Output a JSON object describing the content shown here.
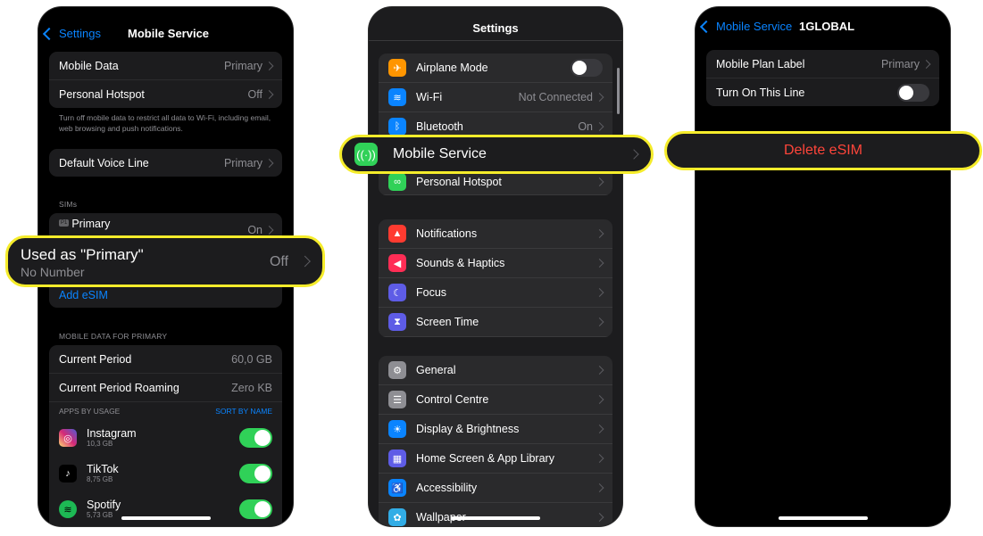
{
  "panel1": {
    "back_label": "Settings",
    "title": "Mobile Service",
    "group1": [
      {
        "label": "Mobile Data",
        "value": "Primary"
      },
      {
        "label": "Personal Hotspot",
        "value": "Off"
      }
    ],
    "footnote": "Turn off mobile data to restrict all data to Wi-Fi, including email, web browsing and push notifications.",
    "default_voice": {
      "label": "Default Voice Line",
      "value": "Primary"
    },
    "sims_header": "SIMs",
    "sim_badge": "P1",
    "sim_label": "Primary",
    "sim_value": "On",
    "add_esim": "Add eSIM",
    "data_header": "MOBILE DATA FOR PRIMARY",
    "current_period": {
      "label": "Current Period",
      "value": "60,0 GB"
    },
    "roaming": {
      "label": "Current Period Roaming",
      "value": "Zero KB"
    },
    "apps_header": "APPS BY USAGE",
    "sort_label": "SORT BY NAME",
    "apps": [
      {
        "name": "Instagram",
        "size": "10,3 GB",
        "on": true
      },
      {
        "name": "TikTok",
        "size": "8,75 GB",
        "on": true
      },
      {
        "name": "Spotify",
        "size": "5,73 GB",
        "on": true
      }
    ],
    "callout": {
      "title": "Used as \"Primary\"",
      "subtitle": "No Number",
      "value": "Off"
    }
  },
  "panel2": {
    "title": "Settings",
    "group1": [
      {
        "label": "Airplane Mode",
        "icon": "airplane-icon",
        "color": "#ff9500",
        "toggle": false
      },
      {
        "label": "Wi-Fi",
        "icon": "wifi-icon",
        "color": "#0a84ff",
        "value": "Not Connected"
      },
      {
        "label": "Bluetooth",
        "icon": "bluetooth-icon",
        "color": "#0a84ff",
        "value": "On"
      },
      {
        "label": "Personal Hotspot",
        "icon": "hotspot-icon",
        "color": "#30d158"
      }
    ],
    "group2": [
      {
        "label": "Notifications",
        "icon": "bell-icon",
        "color": "#ff3b30"
      },
      {
        "label": "Sounds & Haptics",
        "icon": "speaker-icon",
        "color": "#ff2d55"
      },
      {
        "label": "Focus",
        "icon": "moon-icon",
        "color": "#5e5ce6"
      },
      {
        "label": "Screen Time",
        "icon": "hourglass-icon",
        "color": "#5e5ce6"
      }
    ],
    "group3": [
      {
        "label": "General",
        "icon": "gear-icon",
        "color": "#8e8e93"
      },
      {
        "label": "Control Centre",
        "icon": "switches-icon",
        "color": "#8e8e93"
      },
      {
        "label": "Display & Brightness",
        "icon": "sun-icon",
        "color": "#0a84ff"
      },
      {
        "label": "Home Screen & App Library",
        "icon": "grid-icon",
        "color": "#5e5ce6"
      },
      {
        "label": "Accessibility",
        "icon": "accessibility-icon",
        "color": "#0a84ff"
      },
      {
        "label": "Wallpaper",
        "icon": "flower-icon",
        "color": "#32ade6"
      }
    ],
    "callout": {
      "label": "Mobile Service",
      "icon": "antenna-icon",
      "color": "#30d158"
    }
  },
  "panel3": {
    "back_label": "Mobile Service",
    "title": "1GLOBAL",
    "plan_label": {
      "label": "Mobile Plan Label",
      "value": "Primary"
    },
    "turn_on": {
      "label": "Turn On This Line",
      "on": false
    },
    "callout": {
      "label": "Delete eSIM",
      "color": "#ff453a"
    }
  }
}
